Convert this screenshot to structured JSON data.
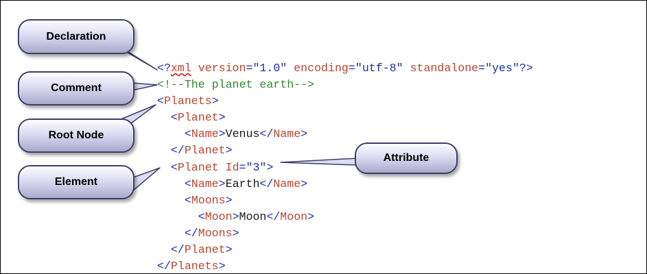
{
  "callouts": {
    "declaration": "Declaration",
    "comment": "Comment",
    "root_node": "Root Node",
    "element": "Element",
    "attribute": "Attribute"
  },
  "xml": {
    "declaration": {
      "open": "<?",
      "name": "xml",
      "version_attr": "version",
      "version_value": "\"1.0\"",
      "encoding_attr": "encoding",
      "encoding_value": "\"utf-8\"",
      "standalone_attr": "standalone",
      "standalone_value": "\"yes\"",
      "close": "?>"
    },
    "comment": "<!--The planet earth-->",
    "root_tag": "Planets",
    "planet_tag": "Planet",
    "name_tag": "Name",
    "planet1_name": "Venus",
    "id_attr": "Id",
    "id_value": "\"3\"",
    "planet2_name": "Earth",
    "moons_tag": "Moons",
    "moon_tag": "Moon",
    "moon_name": "Moon"
  },
  "colors": {
    "bracket": "#1a2fa6",
    "tag": "#b8462f",
    "comment": "#2e8b2e",
    "callout_border": "#3d3d6b"
  }
}
